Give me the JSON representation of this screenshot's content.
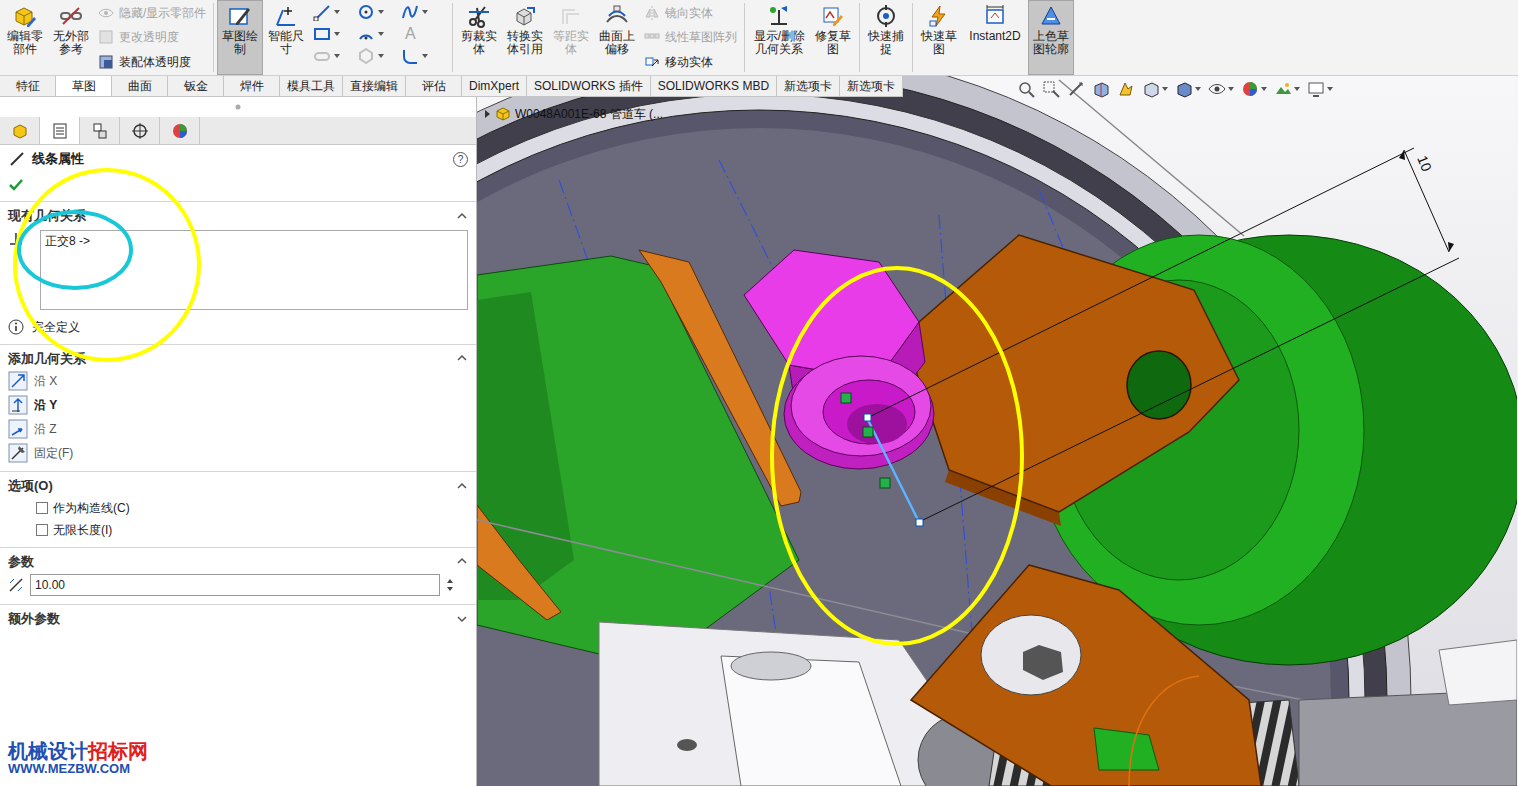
{
  "ribbon_groups": [
    [
      {
        "kind": "large",
        "label": "编辑零部件",
        "selected": false,
        "disabled": false
      },
      {
        "kind": "large",
        "label": "无外部参考",
        "selected": false,
        "disabled": false
      },
      {
        "kind": "stack",
        "items": [
          {
            "label": "隐藏/显示零部件",
            "disabled": true
          },
          {
            "label": "更改透明度",
            "disabled": true
          },
          {
            "label": "装配体透明度",
            "disabled": false
          }
        ]
      }
    ],
    [
      {
        "kind": "large",
        "label": "草图绘制",
        "selected": true,
        "disabled": false
      },
      {
        "kind": "large",
        "label": "智能尺寸",
        "selected": false,
        "disabled": false
      },
      {
        "kind": "tools",
        "text_icon": "A"
      }
    ],
    [
      {
        "kind": "large",
        "label": "剪裁实体",
        "selected": false,
        "disabled": false
      },
      {
        "kind": "large",
        "label": "转换实体引用",
        "selected": false,
        "disabled": false
      },
      {
        "kind": "large",
        "label": "等距实体",
        "selected": false,
        "disabled": true
      },
      {
        "kind": "large",
        "label": "曲面上偏移",
        "selected": false,
        "disabled": false
      },
      {
        "kind": "stack",
        "items": [
          {
            "label": "镜向实体",
            "disabled": true
          },
          {
            "label": "线性草图阵列",
            "disabled": true
          },
          {
            "label": "移动实体",
            "disabled": false
          }
        ]
      }
    ],
    [
      {
        "kind": "large",
        "label": "显示/删除几何关系",
        "selected": false,
        "disabled": false
      },
      {
        "kind": "large",
        "label": "修复草图",
        "selected": false,
        "disabled": false
      }
    ],
    [
      {
        "kind": "large",
        "label": "快速捕捉",
        "selected": false,
        "disabled": false
      }
    ],
    [
      {
        "kind": "large",
        "label": "快速草图",
        "selected": false,
        "disabled": false
      },
      {
        "kind": "large",
        "label": "Instant2D",
        "selected": false,
        "disabled": false
      },
      {
        "kind": "large",
        "label": "上色草图轮廓",
        "selected": true,
        "disabled": false
      }
    ]
  ],
  "tabs": [
    {
      "label": "特征",
      "selected": false
    },
    {
      "label": "草图",
      "selected": true
    },
    {
      "label": "曲面",
      "selected": false
    },
    {
      "label": "钣金",
      "selected": false
    },
    {
      "label": "焊件",
      "selected": false
    },
    {
      "label": "模具工具",
      "selected": false
    },
    {
      "label": "直接编辑",
      "selected": false
    },
    {
      "label": "评估",
      "selected": false
    },
    {
      "label": "DimXpert",
      "selected": false
    },
    {
      "label": "SOLIDWORKS 插件",
      "selected": false
    },
    {
      "label": "SOLIDWORKS MBD",
      "selected": false
    },
    {
      "label": "新选项卡",
      "selected": false
    },
    {
      "label": "新选项卡",
      "selected": false
    }
  ],
  "property_manager": {
    "tabs": [
      {
        "selected": false
      },
      {
        "selected": true
      },
      {
        "selected": false
      },
      {
        "selected": false
      },
      {
        "selected": false
      }
    ],
    "title": "线条属性",
    "help": "?",
    "sections": [
      {
        "kind": "relations",
        "title": "现有几何关系",
        "expanded": true,
        "relations": [
          "正交8 ->"
        ],
        "status": "完全定义"
      },
      {
        "kind": "add",
        "title": "添加几何关系",
        "expanded": true,
        "items": [
          {
            "label": "沿 X",
            "emphasized": false
          },
          {
            "label": "沿 Y",
            "emphasized": true
          },
          {
            "label": "沿 Z",
            "emphasized": false
          },
          {
            "label": "固定(F)",
            "emphasized": false
          }
        ]
      },
      {
        "kind": "options",
        "title": "选项(O)",
        "expanded": true,
        "options": [
          {
            "label": "作为构造线(C)",
            "checked": false
          },
          {
            "label": "无限长度(I)",
            "checked": false
          }
        ]
      },
      {
        "kind": "params",
        "title": "参数",
        "expanded": true,
        "value": "10.00"
      },
      {
        "kind": "extra",
        "title": "额外参数",
        "expanded": false
      }
    ]
  },
  "viewport": {
    "tree_label": "W0048A001E-68 管道车 (...",
    "dimension": "10"
  },
  "watermark": {
    "parts": [
      {
        "text": "机械设计",
        "color": "#1f4fb0"
      },
      {
        "text": "招标网",
        "color": "#e0201c"
      }
    ],
    "url": "WWW.MEZBW.COM"
  }
}
